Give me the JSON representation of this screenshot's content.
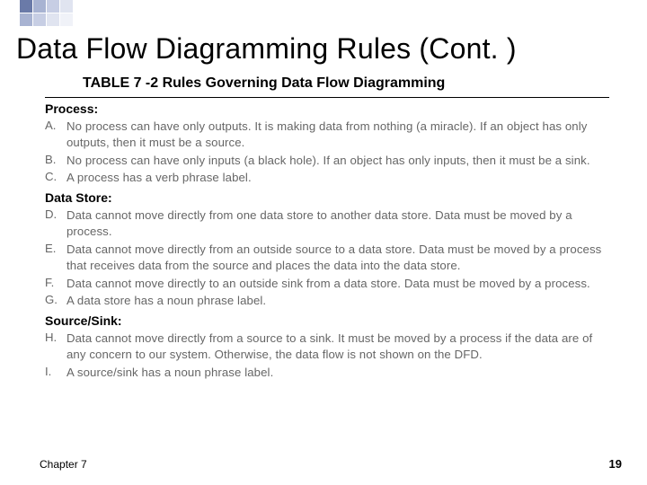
{
  "decor": {
    "colors_row1": [
      "#6a7aa8",
      "#a8b3d2",
      "#c7cee4",
      "#e0e4f0"
    ],
    "colors_row2": [
      "#a8b3d2",
      "#c7cee4",
      "#e0e4f0",
      "#f0f2f8"
    ]
  },
  "title": "Data Flow Diagramming Rules (Cont. )",
  "subtitle": "TABLE 7 -2 Rules Governing Data Flow Diagramming",
  "sections": [
    {
      "heading": "Process:",
      "rules": [
        {
          "letter": "A.",
          "text": "No process can have only outputs. It is making data from nothing (a miracle). If an object has only outputs, then it must be a source."
        },
        {
          "letter": "B.",
          "text": "No process can have only inputs (a black hole). If an object has only inputs, then it must be a sink."
        },
        {
          "letter": "C.",
          "text": "A process has a verb phrase label."
        }
      ]
    },
    {
      "heading": "Data Store:",
      "rules": [
        {
          "letter": "D.",
          "text": "Data cannot move directly from one data store to another data store. Data must be moved by a process."
        },
        {
          "letter": "E.",
          "text": "Data cannot move directly from an outside source to a data store. Data must be moved by a process that receives data from the source and places the data into the data store."
        },
        {
          "letter": "F.",
          "text": "Data cannot move directly to an outside sink from a data store. Data must be moved by a process."
        },
        {
          "letter": "G.",
          "text": "A data store has a noun phrase label."
        }
      ]
    },
    {
      "heading": "Source/Sink:",
      "rules": [
        {
          "letter": "H.",
          "text": "Data cannot move directly from a source to a sink. It must be moved by a process if the data are of any concern to our system. Otherwise, the data flow is not shown on the DFD."
        },
        {
          "letter": "I.",
          "text": "A source/sink has a noun phrase label."
        }
      ]
    }
  ],
  "footer": {
    "left": "Chapter 7",
    "right": "19"
  }
}
